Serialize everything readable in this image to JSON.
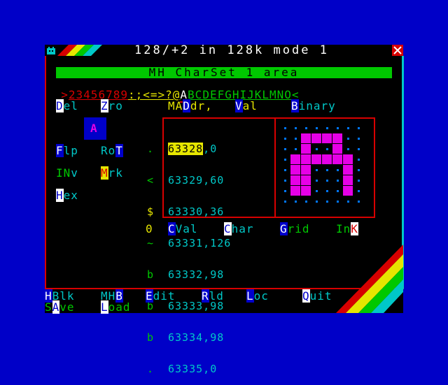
{
  "title": "128/+2 in 128k mode 1",
  "header": {
    "area_label": "MH CharSet 1 area",
    "charstrip": {
      "left_arrow": ">",
      "right_arrow": "<",
      "red_chars": "23456789",
      "yellow_chars": ":;<=>?@",
      "selected_char": "A",
      "green_chars": "BCDEFGHIJKLMNO"
    }
  },
  "menu_top": {
    "del": {
      "key": "D",
      "rest": "el"
    },
    "zro": {
      "key": "Z",
      "rest": "ro"
    },
    "maddr": {
      "pre": "MA",
      "key": "D",
      "rest": "dr,"
    },
    "val": {
      "key": "V",
      "rest": "al"
    },
    "binary": {
      "key": "B",
      "rest": "inary"
    }
  },
  "preview_char": "A",
  "side_buttons": {
    "flp": {
      "key": "F",
      "rest": "lp"
    },
    "rot": {
      "pre": "Ro",
      "key": "T"
    },
    "inv": {
      "key": "IN",
      "rest": "v"
    },
    "mrk": {
      "key": "M",
      "rest": "rk"
    },
    "hex": {
      "key": "H",
      "rest": "ex"
    }
  },
  "glyph_column": [
    ".",
    "<",
    "$",
    "~",
    "b",
    "b",
    "b",
    "."
  ],
  "memory_rows": [
    {
      "addr": "63328",
      "val": "0"
    },
    {
      "addr": "63329",
      "val": "60"
    },
    {
      "addr": "63330",
      "val": "36"
    },
    {
      "addr": "63331",
      "val": "126"
    },
    {
      "addr": "63332",
      "val": "98"
    },
    {
      "addr": "63333",
      "val": "98"
    },
    {
      "addr": "63334",
      "val": "98"
    },
    {
      "addr": "63335",
      "val": "0"
    }
  ],
  "selected_row": 0,
  "bitmap": [
    0,
    60,
    36,
    126,
    98,
    98,
    98,
    0
  ],
  "bottom_options": {
    "zero": "0",
    "cval": {
      "key": "C",
      "rest": "Val"
    },
    "char": {
      "key": "C",
      "rest": "har"
    },
    "grid": {
      "key": "G",
      "rest": "rid"
    },
    "ink": {
      "pre": "In",
      "key": "K"
    }
  },
  "footer_menu": {
    "hblk": {
      "key": "H",
      "rest": "Blk"
    },
    "mhb": {
      "pre": "MH",
      "key": "B"
    },
    "edit": {
      "key": "E",
      "rest": "dit"
    },
    "rld": {
      "key": "R",
      "rest": "ld"
    },
    "loc": {
      "key": "L",
      "rest": "oc"
    },
    "quit": {
      "key": "Q",
      "rest": "uit"
    },
    "save": {
      "pre": "S",
      "key": "A",
      "rest": "ve"
    },
    "load": {
      "key": "L",
      "rest": "oad"
    }
  },
  "colors": {
    "border": "#0000c8",
    "paper": "#000000",
    "cyan": "#00c8c8",
    "yellow": "#e6e600",
    "green": "#00c800",
    "red": "#d70000",
    "magenta": "#e600e6",
    "white": "#ffffff"
  }
}
